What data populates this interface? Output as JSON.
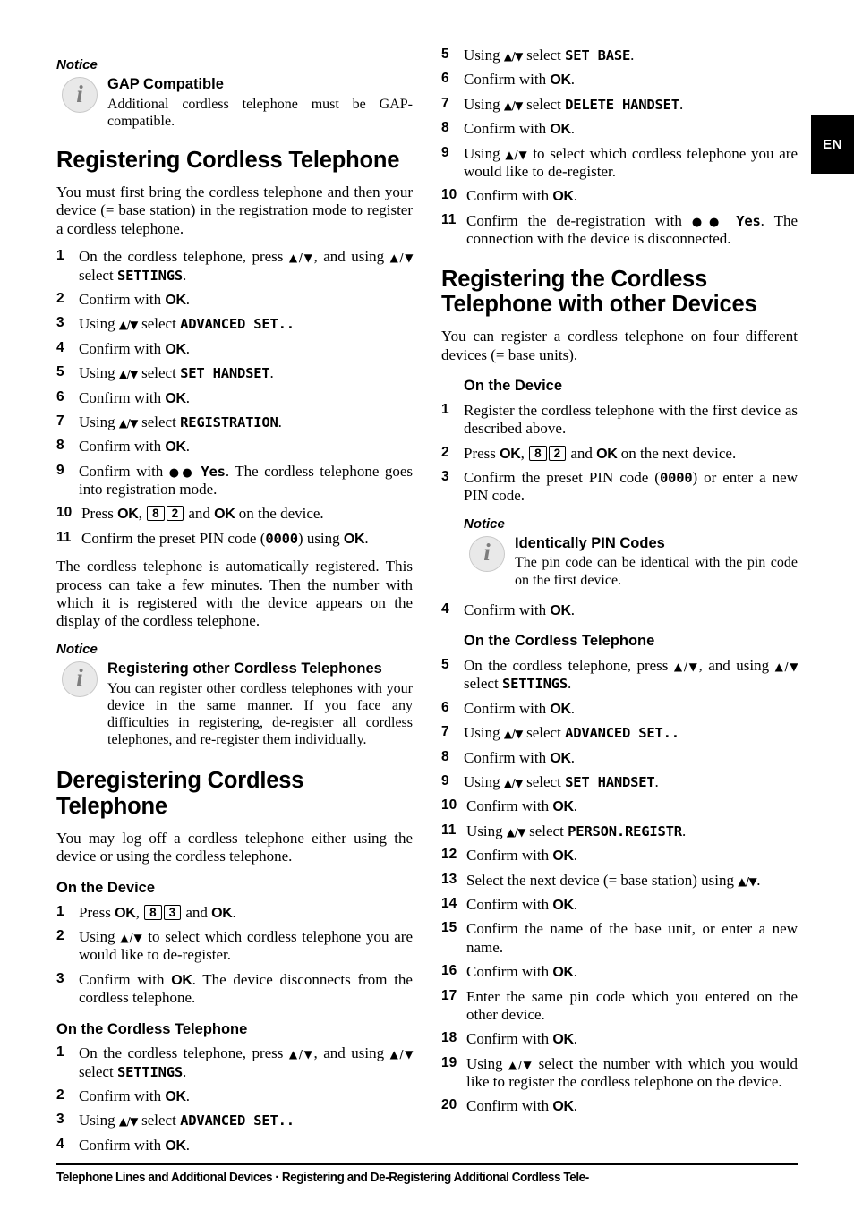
{
  "lang_tab": "EN",
  "notice_label": "Notice",
  "left_column": {
    "notice_gap": {
      "label": "Notice",
      "icon": "info-icon",
      "title": "GAP Compatible",
      "body": "Additional cordless telephone must be GAP-compatible."
    },
    "heading_registering": "Registering Cordless Telephone",
    "intro": "You must first bring the cordless telephone and then your device (= base station) in the registration mode to register a cordless telephone.",
    "steps_registering": [
      {
        "n": "1",
        "parts": [
          {
            "t": "On the cordless telephone, press "
          },
          {
            "arrows": "▲/▼"
          },
          {
            "t": ", and using "
          },
          {
            "arrows": "▲/▼"
          },
          {
            "t": " select "
          },
          {
            "lcd": "SETTINGS"
          },
          {
            "t": "."
          }
        ]
      },
      {
        "n": "2",
        "parts": [
          {
            "t": "Confirm with "
          },
          {
            "key": "OK"
          },
          {
            "t": "."
          }
        ]
      },
      {
        "n": "3",
        "parts": [
          {
            "t": "Using "
          },
          {
            "arrows": "▲/▼"
          },
          {
            "t": " select "
          },
          {
            "lcd": "ADVANCED SET.."
          }
        ]
      },
      {
        "n": "4",
        "parts": [
          {
            "t": "Confirm with "
          },
          {
            "key": "OK"
          },
          {
            "t": "."
          }
        ]
      },
      {
        "n": "5",
        "parts": [
          {
            "t": "Using "
          },
          {
            "arrows": "▲/▼"
          },
          {
            "t": " select "
          },
          {
            "lcd": "SET HANDSET"
          },
          {
            "t": "."
          }
        ]
      },
      {
        "n": "6",
        "parts": [
          {
            "t": "Confirm with "
          },
          {
            "key": "OK"
          },
          {
            "t": "."
          }
        ]
      },
      {
        "n": "7",
        "parts": [
          {
            "t": "Using "
          },
          {
            "arrows": "▲/▼"
          },
          {
            "t": " select "
          },
          {
            "lcd": "REGISTRATION"
          },
          {
            "t": "."
          }
        ]
      },
      {
        "n": "8",
        "parts": [
          {
            "t": "Confirm with "
          },
          {
            "key": "OK"
          },
          {
            "t": "."
          }
        ]
      },
      {
        "n": "9",
        "parts": [
          {
            "t": "Confirm with "
          },
          {
            "dots": "●●"
          },
          {
            "t": " "
          },
          {
            "lcd": "Yes"
          },
          {
            "t": ". The cordless telephone goes into registration mode."
          }
        ]
      },
      {
        "n": "10",
        "parts": [
          {
            "t": "Press "
          },
          {
            "key": "OK"
          },
          {
            "t": ", "
          },
          {
            "btn": "8"
          },
          {
            "btn": "2"
          },
          {
            "t": " and "
          },
          {
            "key": "OK"
          },
          {
            "t": " on the device."
          }
        ]
      },
      {
        "n": "11",
        "parts": [
          {
            "t": "Confirm the preset PIN code ("
          },
          {
            "lcd": "0000"
          },
          {
            "t": ") using "
          },
          {
            "key": "OK"
          },
          {
            "t": "."
          }
        ]
      }
    ],
    "outro": "The cordless telephone is automatically registered. This process can take a few minutes. Then the number with which it is registered with the device appears on the display of the cordless telephone.",
    "notice_other": {
      "label": "Notice",
      "icon": "info-icon",
      "title": "Registering other Cordless Telephones",
      "body": "You can register other cordless telephones with your device in the same manner. If you face any difficulties in registering, de-register all cordless telephones, and re-register them individually."
    },
    "heading_deregistering": "Deregistering Cordless Telephone",
    "deregister_intro": "You may log off a cordless telephone either using the device or using the cordless telephone.",
    "subheading_device": "On the Device",
    "steps_device": [
      {
        "n": "1",
        "parts": [
          {
            "t": "Press "
          },
          {
            "key": "OK"
          },
          {
            "t": ", "
          },
          {
            "btn": "8"
          },
          {
            "btn": "3"
          },
          {
            "t": " and "
          },
          {
            "key": "OK"
          },
          {
            "t": "."
          }
        ]
      },
      {
        "n": "2",
        "parts": [
          {
            "t": "Using "
          },
          {
            "arrows": "▲/▼"
          },
          {
            "t": " to select which cordless telephone you are would like to de-register."
          }
        ]
      },
      {
        "n": "3",
        "parts": [
          {
            "t": "Confirm with "
          },
          {
            "key": "OK"
          },
          {
            "t": ". The device disconnects from the cordless telephone."
          }
        ]
      }
    ],
    "subheading_cordless": "On the Cordless Telephone",
    "steps_cordless": [
      {
        "n": "1",
        "parts": [
          {
            "t": "On the cordless telephone, press "
          },
          {
            "arrows": "▲/▼"
          },
          {
            "t": ", and using "
          },
          {
            "arrows": "▲/▼"
          },
          {
            "t": " select "
          },
          {
            "lcd": "SETTINGS"
          },
          {
            "t": "."
          }
        ]
      },
      {
        "n": "2",
        "parts": [
          {
            "t": "Confirm with "
          },
          {
            "key": "OK"
          },
          {
            "t": "."
          }
        ]
      },
      {
        "n": "3",
        "parts": [
          {
            "t": "Using "
          },
          {
            "arrows": "▲/▼"
          },
          {
            "t": " select "
          },
          {
            "lcd": "ADVANCED SET.."
          }
        ]
      },
      {
        "n": "4",
        "parts": [
          {
            "t": "Confirm with "
          },
          {
            "key": "OK"
          },
          {
            "t": "."
          }
        ]
      }
    ]
  },
  "right_column": {
    "steps_cordless_cont": [
      {
        "n": "5",
        "parts": [
          {
            "t": "Using "
          },
          {
            "arrows": "▲/▼"
          },
          {
            "t": " select "
          },
          {
            "lcd": "SET BASE"
          },
          {
            "t": "."
          }
        ]
      },
      {
        "n": "6",
        "parts": [
          {
            "t": "Confirm with "
          },
          {
            "key": "OK"
          },
          {
            "t": "."
          }
        ]
      },
      {
        "n": "7",
        "parts": [
          {
            "t": "Using "
          },
          {
            "arrows": "▲/▼"
          },
          {
            "t": " select "
          },
          {
            "lcd": "DELETE HANDSET"
          },
          {
            "t": "."
          }
        ]
      },
      {
        "n": "8",
        "parts": [
          {
            "t": "Confirm with "
          },
          {
            "key": "OK"
          },
          {
            "t": "."
          }
        ]
      },
      {
        "n": "9",
        "parts": [
          {
            "t": "Using "
          },
          {
            "arrows": "▲/▼"
          },
          {
            "t": " to select which cordless telephone you are would like to de-register."
          }
        ]
      },
      {
        "n": "10",
        "parts": [
          {
            "t": "Confirm with "
          },
          {
            "key": "OK"
          },
          {
            "t": "."
          }
        ]
      },
      {
        "n": "11",
        "parts": [
          {
            "t": "Confirm the de-registration with "
          },
          {
            "dots": "●●"
          },
          {
            "t": " "
          },
          {
            "lcd": "Yes"
          },
          {
            "t": ". The connection with the device is disconnected."
          }
        ]
      }
    ],
    "heading_other_devices": "Registering the Cordless Telephone with other Devices",
    "other_intro": "You can register a cordless telephone on four different devices (= base units).",
    "subheading_device": "On the Device",
    "steps_other_device": [
      {
        "n": "1",
        "parts": [
          {
            "t": "Register the cordless telephone with the first device as described above."
          }
        ]
      },
      {
        "n": "2",
        "parts": [
          {
            "t": "Press "
          },
          {
            "key": "OK"
          },
          {
            "t": ", "
          },
          {
            "btn": "8"
          },
          {
            "btn": "2"
          },
          {
            "t": " and "
          },
          {
            "key": "OK"
          },
          {
            "t": " on the next device."
          }
        ]
      },
      {
        "n": "3",
        "parts": [
          {
            "t": "Confirm the preset PIN code ("
          },
          {
            "lcd": "0000"
          },
          {
            "t": ") or enter a new PIN code."
          }
        ]
      }
    ],
    "notice_pin": {
      "label": "Notice",
      "icon": "info-icon",
      "title": "Identically PIN Codes",
      "body": "The pin code can be identical with the pin code on the first device."
    },
    "steps_after_notice": [
      {
        "n": "4",
        "parts": [
          {
            "t": "Confirm with "
          },
          {
            "key": "OK"
          },
          {
            "t": "."
          }
        ]
      }
    ],
    "subheading_cordless": "On the Cordless Telephone",
    "steps_other_cordless": [
      {
        "n": "5",
        "parts": [
          {
            "t": "On the cordless telephone, press "
          },
          {
            "arrows": "▲/▼"
          },
          {
            "t": ", and using "
          },
          {
            "arrows": "▲/▼"
          },
          {
            "t": " select "
          },
          {
            "lcd": "SETTINGS"
          },
          {
            "t": "."
          }
        ]
      },
      {
        "n": "6",
        "parts": [
          {
            "t": "Confirm with "
          },
          {
            "key": "OK"
          },
          {
            "t": "."
          }
        ]
      },
      {
        "n": "7",
        "parts": [
          {
            "t": "Using "
          },
          {
            "arrows": "▲/▼"
          },
          {
            "t": " select "
          },
          {
            "lcd": "ADVANCED SET.."
          }
        ]
      },
      {
        "n": "8",
        "parts": [
          {
            "t": "Confirm with "
          },
          {
            "key": "OK"
          },
          {
            "t": "."
          }
        ]
      },
      {
        "n": "9",
        "parts": [
          {
            "t": "Using "
          },
          {
            "arrows": "▲/▼"
          },
          {
            "t": " select "
          },
          {
            "lcd": "SET HANDSET"
          },
          {
            "t": "."
          }
        ]
      },
      {
        "n": "10",
        "parts": [
          {
            "t": "Confirm with "
          },
          {
            "key": "OK"
          },
          {
            "t": "."
          }
        ]
      },
      {
        "n": "11",
        "parts": [
          {
            "t": "Using "
          },
          {
            "arrows": "▲/▼"
          },
          {
            "t": " select "
          },
          {
            "lcd": "PERSON.REGISTR"
          },
          {
            "t": "."
          }
        ]
      },
      {
        "n": "12",
        "parts": [
          {
            "t": "Confirm with "
          },
          {
            "key": "OK"
          },
          {
            "t": "."
          }
        ]
      },
      {
        "n": "13",
        "parts": [
          {
            "t": "Select the next device (= base station) using "
          },
          {
            "arrows": "▲/▼"
          },
          {
            "t": "."
          }
        ]
      },
      {
        "n": "14",
        "parts": [
          {
            "t": "Confirm with "
          },
          {
            "key": "OK"
          },
          {
            "t": "."
          }
        ]
      },
      {
        "n": "15",
        "parts": [
          {
            "t": "Confirm the name of the base unit, or enter a new name."
          }
        ]
      },
      {
        "n": "16",
        "parts": [
          {
            "t": "Confirm with "
          },
          {
            "key": "OK"
          },
          {
            "t": "."
          }
        ]
      },
      {
        "n": "17",
        "parts": [
          {
            "t": "Enter the same pin code which you entered on the other device."
          }
        ]
      },
      {
        "n": "18",
        "parts": [
          {
            "t": "Confirm with "
          },
          {
            "key": "OK"
          },
          {
            "t": "."
          }
        ]
      },
      {
        "n": "19",
        "parts": [
          {
            "t": "Using "
          },
          {
            "arrows": "▲/▼"
          },
          {
            "t": " select the number with which you would like to register the cordless telephone on the device."
          }
        ]
      },
      {
        "n": "20",
        "parts": [
          {
            "t": "Confirm with "
          },
          {
            "key": "OK"
          },
          {
            "t": "."
          }
        ]
      }
    ]
  },
  "footer": {
    "text": "Telephone Lines and Additional Devices  · Registering and De-Registering Additional Cordless Tele-"
  }
}
